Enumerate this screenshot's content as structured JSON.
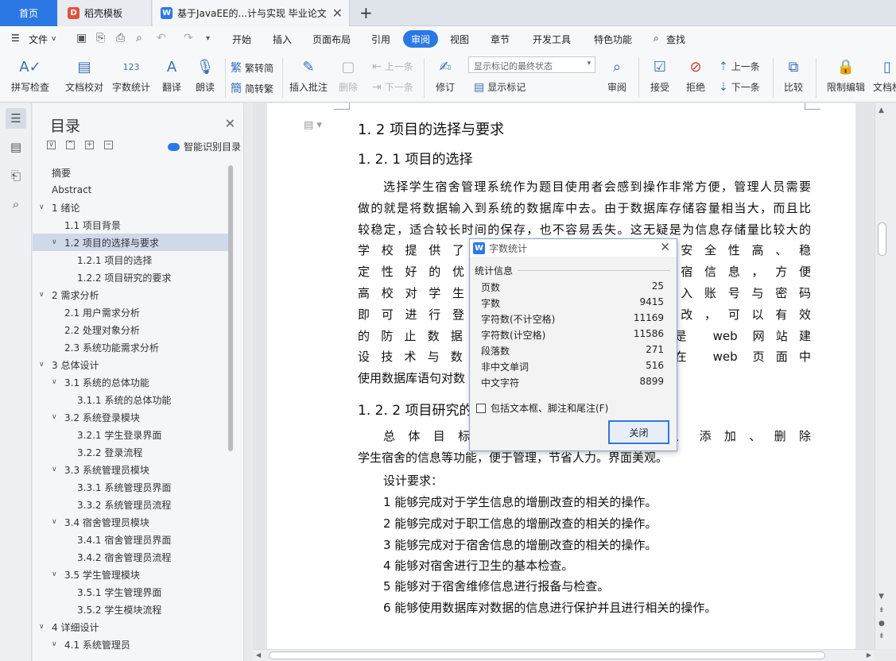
{
  "tabs": {
    "home": "首页",
    "template": "稻壳模板",
    "doc": "基于JavaEE的...计与实现 毕业论文",
    "template_icon": "D",
    "doc_icon": "W"
  },
  "menu": {
    "file": "文件",
    "items": [
      "开始",
      "插入",
      "页面布局",
      "引用",
      "审阅",
      "视图",
      "章节",
      "开发工具",
      "特色功能"
    ],
    "search": "查找"
  },
  "ribbon": {
    "spellcheck": "拼写检查",
    "doccheck": "文档校对",
    "wordcount": "字数统计",
    "translate": "翻译",
    "read": "朗读",
    "to_trad": "繁转简",
    "to_simp": "简转繁",
    "insert_comment": "插入批注",
    "delete": "删除",
    "prev_comment": "上一条",
    "next_comment": "下一条",
    "revise": "修订",
    "markup_select": "显示标记的最终状态",
    "show_markup": "显示标记",
    "review": "审阅",
    "accept": "接受",
    "reject": "拒绝",
    "prev_change": "上一条",
    "next_change": "下一条",
    "compare": "比较",
    "restrict": "限制编辑",
    "doc_right": "文档权"
  },
  "toc": {
    "title": "目录",
    "smart": "智能识别目录",
    "items": [
      {
        "label": "摘要",
        "level": 0,
        "arrow": ""
      },
      {
        "label": "Abstract",
        "level": 0,
        "arrow": ""
      },
      {
        "label": "1  绪论",
        "level": 0,
        "arrow": "v"
      },
      {
        "label": "1.1 项目背景",
        "level": 1,
        "arrow": ""
      },
      {
        "label": "1.2 项目的选择与要求",
        "level": 1,
        "arrow": "v",
        "active": true
      },
      {
        "label": "1.2.1  项目的选择",
        "level": 2,
        "arrow": ""
      },
      {
        "label": "1.2.2  项目研究的要求",
        "level": 2,
        "arrow": ""
      },
      {
        "label": "2  需求分析",
        "level": 0,
        "arrow": "v"
      },
      {
        "label": "2.1  用户需求分析",
        "level": 1,
        "arrow": ""
      },
      {
        "label": "2.2  处理对象分析",
        "level": 1,
        "arrow": ""
      },
      {
        "label": "2.3  系统功能需求分析",
        "level": 1,
        "arrow": ""
      },
      {
        "label": "3  总体设计",
        "level": 0,
        "arrow": "v"
      },
      {
        "label": "3.1  系统的总体功能",
        "level": 1,
        "arrow": "v"
      },
      {
        "label": "3.1.1  系统的总体功能",
        "level": 2,
        "arrow": ""
      },
      {
        "label": "3.2  系统登录模块",
        "level": 1,
        "arrow": "v"
      },
      {
        "label": "3.2.1  学生登录界面",
        "level": 2,
        "arrow": ""
      },
      {
        "label": "3.2.2  登录流程",
        "level": 2,
        "arrow": ""
      },
      {
        "label": "3.3  系统管理员模块",
        "level": 1,
        "arrow": "v"
      },
      {
        "label": "3.3.1  系统管理员界面",
        "level": 2,
        "arrow": ""
      },
      {
        "label": "3.3.2  系统管理员流程",
        "level": 2,
        "arrow": ""
      },
      {
        "label": "3.4  宿舍管理员模块",
        "level": 1,
        "arrow": "v"
      },
      {
        "label": "3.4.1  宿舍管理员界面",
        "level": 2,
        "arrow": ""
      },
      {
        "label": "3.4.2  宿舍管理员流程",
        "level": 2,
        "arrow": ""
      },
      {
        "label": "3.5  学生管理模块",
        "level": 1,
        "arrow": "v"
      },
      {
        "label": "3.5.1  学生管理界面",
        "level": 2,
        "arrow": ""
      },
      {
        "label": "3.5.2  学生模块流程",
        "level": 2,
        "arrow": ""
      },
      {
        "label": "4  详细设计",
        "level": 0,
        "arrow": "v"
      },
      {
        "label": "4.1  系统管理员",
        "level": 1,
        "arrow": "v"
      }
    ]
  },
  "doc": {
    "h_12": "1. 2 项目的选择与要求",
    "h_121": "1. 2. 1  项目的选择",
    "p1": [
      "选择学生宿舍管理系统作为题目使用者会感到操作非常方便，管理人员需要",
      "做的就是将数据输入到系统的数据库中去。由于数据库存储容量相当大，而且比",
      "较稳定，适合较长时间的保存，也不容易丢失。这无疑是为信息存储量比较大的",
      "学校提供了一个方便                                  速度快、安全性高、稳",
      "定性好的优点，并且                                  所需的住宿信息，方便",
      "高校对学生宿舍的管                                  者需要键入账号与密码",
      "即可进行登录的操作                                  数据的篡改，可以有效",
      "的防止数据的泄露。                                  统使用的是 web 网站建",
      "设技术与数据库的结                                  的美化，在 web 页面中",
      "使用数据库语句对数"
    ],
    "h_122": "1. 2. 2  项目研究的",
    "p2": [
      "总体目标：成功                                      可以查询、添加、删除",
      "学生宿舍的信息等功能，便于管理，节省人力。界面美观。"
    ],
    "design_req": "设计要求：",
    "reqs": [
      "1  能够完成对于学生信息的增删改查的相关的操作。",
      "2  能够完成对于职工信息的增删改查的相关的操作。",
      "3  能够完成对于宿舍信息的增删改查的相关的操作。",
      "4  能够对宿舍进行卫生的基本检查。",
      "5  能够对于宿舍维修信息进行报备与检查。",
      "6  能够使用数据库对数据的信息进行保护并且进行相关的操作。"
    ]
  },
  "dialog": {
    "title": "字数统计",
    "group": "统计信息",
    "stats": [
      {
        "label": "页数",
        "value": "25"
      },
      {
        "label": "字数",
        "value": "9415"
      },
      {
        "label": "字符数(不计空格)",
        "value": "11169"
      },
      {
        "label": "字符数(计空格)",
        "value": "11586"
      },
      {
        "label": "段落数",
        "value": "271"
      },
      {
        "label": "非中文单词",
        "value": "516"
      },
      {
        "label": "中文字符",
        "value": "8899"
      }
    ],
    "include_label": "包括文本框、脚注和尾注(F)",
    "close_label": "关闭"
  },
  "colors": {
    "accent": "#2b78e4",
    "toc_active": "#cfd9ea"
  }
}
